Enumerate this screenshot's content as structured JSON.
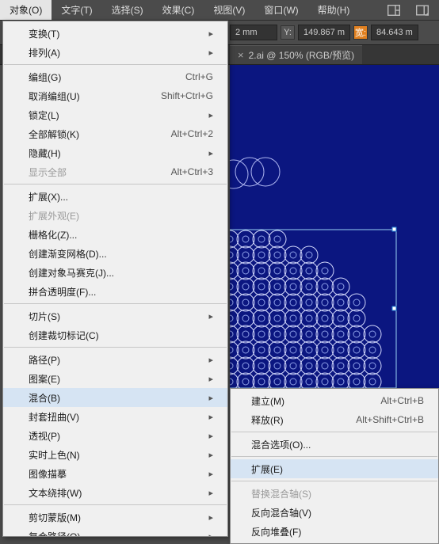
{
  "menubar": {
    "items": [
      "对象(O)",
      "文字(T)",
      "选择(S)",
      "效果(C)",
      "视图(V)",
      "窗口(W)",
      "帮助(H)"
    ]
  },
  "toolbar": {
    "xsuffix": "2 mm",
    "y_label": "Y:",
    "y_value": "149.867 m",
    "w_label": "宽:",
    "w_value": "84.643 m"
  },
  "tab": {
    "label": "2.ai @ 150% (RGB/预览)"
  },
  "menu": {
    "sec1": [
      {
        "label": "变换(T)",
        "sub": true
      },
      {
        "label": "排列(A)",
        "sub": true
      }
    ],
    "sec2": [
      {
        "label": "编组(G)",
        "sc": "Ctrl+G"
      },
      {
        "label": "取消编组(U)",
        "sc": "Shift+Ctrl+G"
      },
      {
        "label": "锁定(L)",
        "sub": true
      },
      {
        "label": "全部解锁(K)",
        "sc": "Alt+Ctrl+2"
      },
      {
        "label": "隐藏(H)",
        "sub": true
      },
      {
        "label": "显示全部",
        "sc": "Alt+Ctrl+3",
        "dis": true
      }
    ],
    "sec3": [
      {
        "label": "扩展(X)..."
      },
      {
        "label": "扩展外观(E)",
        "dis": true
      },
      {
        "label": "栅格化(Z)..."
      },
      {
        "label": "创建渐变网格(D)..."
      },
      {
        "label": "创建对象马赛克(J)..."
      },
      {
        "label": "拼合透明度(F)..."
      }
    ],
    "sec4": [
      {
        "label": "切片(S)",
        "sub": true
      },
      {
        "label": "创建裁切标记(C)"
      }
    ],
    "sec5": [
      {
        "label": "路径(P)",
        "sub": true
      },
      {
        "label": "图案(E)",
        "sub": true
      },
      {
        "label": "混合(B)",
        "sub": true,
        "hl": true
      },
      {
        "label": "封套扭曲(V)",
        "sub": true
      },
      {
        "label": "透视(P)",
        "sub": true
      },
      {
        "label": "实时上色(N)",
        "sub": true
      },
      {
        "label": "图像描摹",
        "sub": true
      },
      {
        "label": "文本绕排(W)",
        "sub": true
      }
    ],
    "sec6": [
      {
        "label": "剪切蒙版(M)",
        "sub": true
      },
      {
        "label": "复合路径(O)",
        "sub": true
      }
    ]
  },
  "submenu": {
    "items": [
      {
        "label": "建立(M)",
        "sc": "Alt+Ctrl+B"
      },
      {
        "label": "释放(R)",
        "sc": "Alt+Shift+Ctrl+B"
      },
      {
        "sep": true
      },
      {
        "label": "混合选项(O)..."
      },
      {
        "sep": true
      },
      {
        "label": "扩展(E)",
        "hl": true
      },
      {
        "sep": true
      },
      {
        "label": "替换混合轴(S)",
        "dis": true
      },
      {
        "label": "反向混合轴(V)"
      },
      {
        "label": "反向堆叠(F)"
      }
    ]
  }
}
